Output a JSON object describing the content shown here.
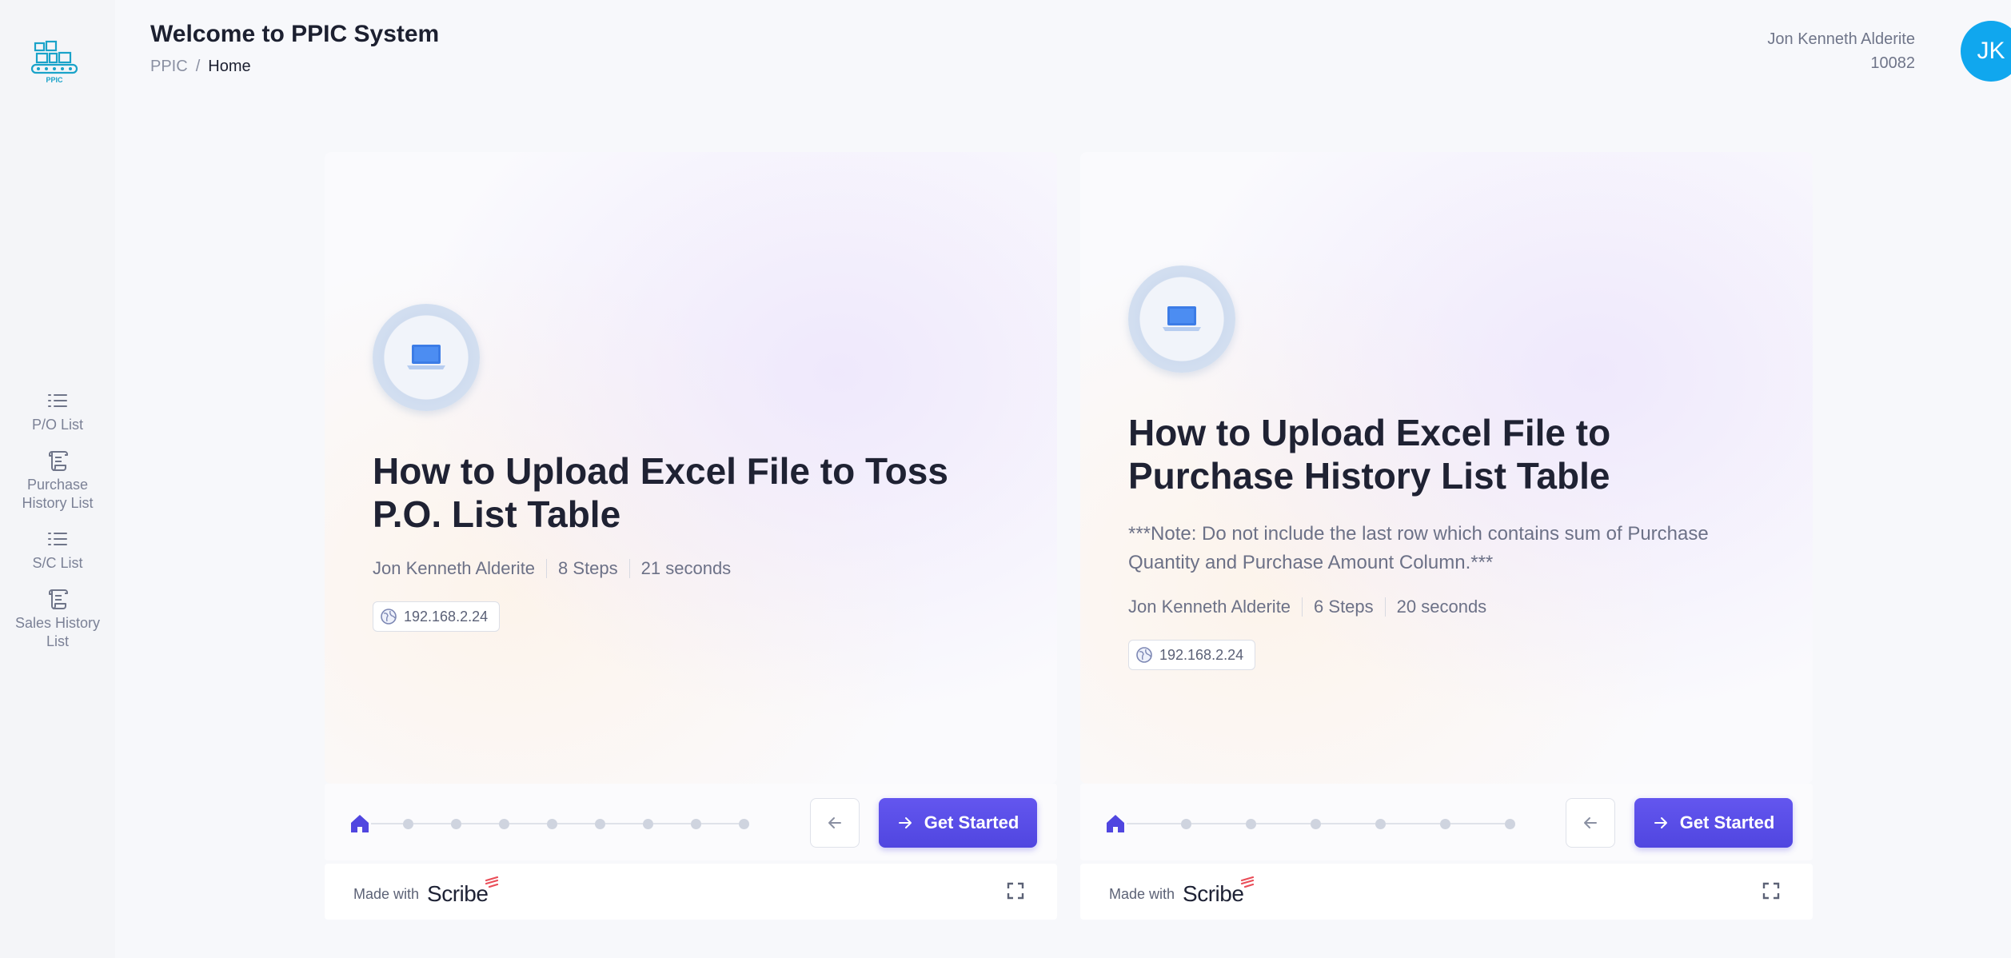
{
  "app": {
    "logo_text": "PPIC"
  },
  "sidebar": {
    "items": [
      {
        "label": "P/O List",
        "icon": "list-icon"
      },
      {
        "label": "Purchase History List",
        "icon": "scroll-icon"
      },
      {
        "label": "S/C List",
        "icon": "list-icon"
      },
      {
        "label": "Sales History List",
        "icon": "scroll-icon"
      }
    ]
  },
  "header": {
    "title": "Welcome to PPIC System",
    "breadcrumb": {
      "root": "PPIC",
      "separator": "/",
      "current": "Home"
    },
    "user": {
      "name": "Jon Kenneth Alderite",
      "id": "10082",
      "initials": "JK"
    }
  },
  "cards": [
    {
      "title": "How to Upload Excel File to Toss P.O. List Table",
      "note": "",
      "author": "Jon Kenneth Alderite",
      "steps": "8 Steps",
      "step_count": 8,
      "duration": "21 seconds",
      "ip": "192.168.2.24",
      "get_started_label": "Get Started",
      "made_with": "Made with",
      "brand": "Scribe"
    },
    {
      "title": "How to Upload Excel File to Purchase History List Table",
      "note": "***Note: Do not include the last row which contains sum of Purchase Quantity and Purchase Amount Column.***",
      "author": "Jon Kenneth Alderite",
      "steps": "6 Steps",
      "step_count": 6,
      "duration": "20 seconds",
      "ip": "192.168.2.24",
      "get_started_label": "Get Started",
      "made_with": "Made with",
      "brand": "Scribe"
    }
  ],
  "colors": {
    "accent": "#5046e0",
    "avatar": "#10a7ee",
    "logo": "#1aa3c9"
  }
}
